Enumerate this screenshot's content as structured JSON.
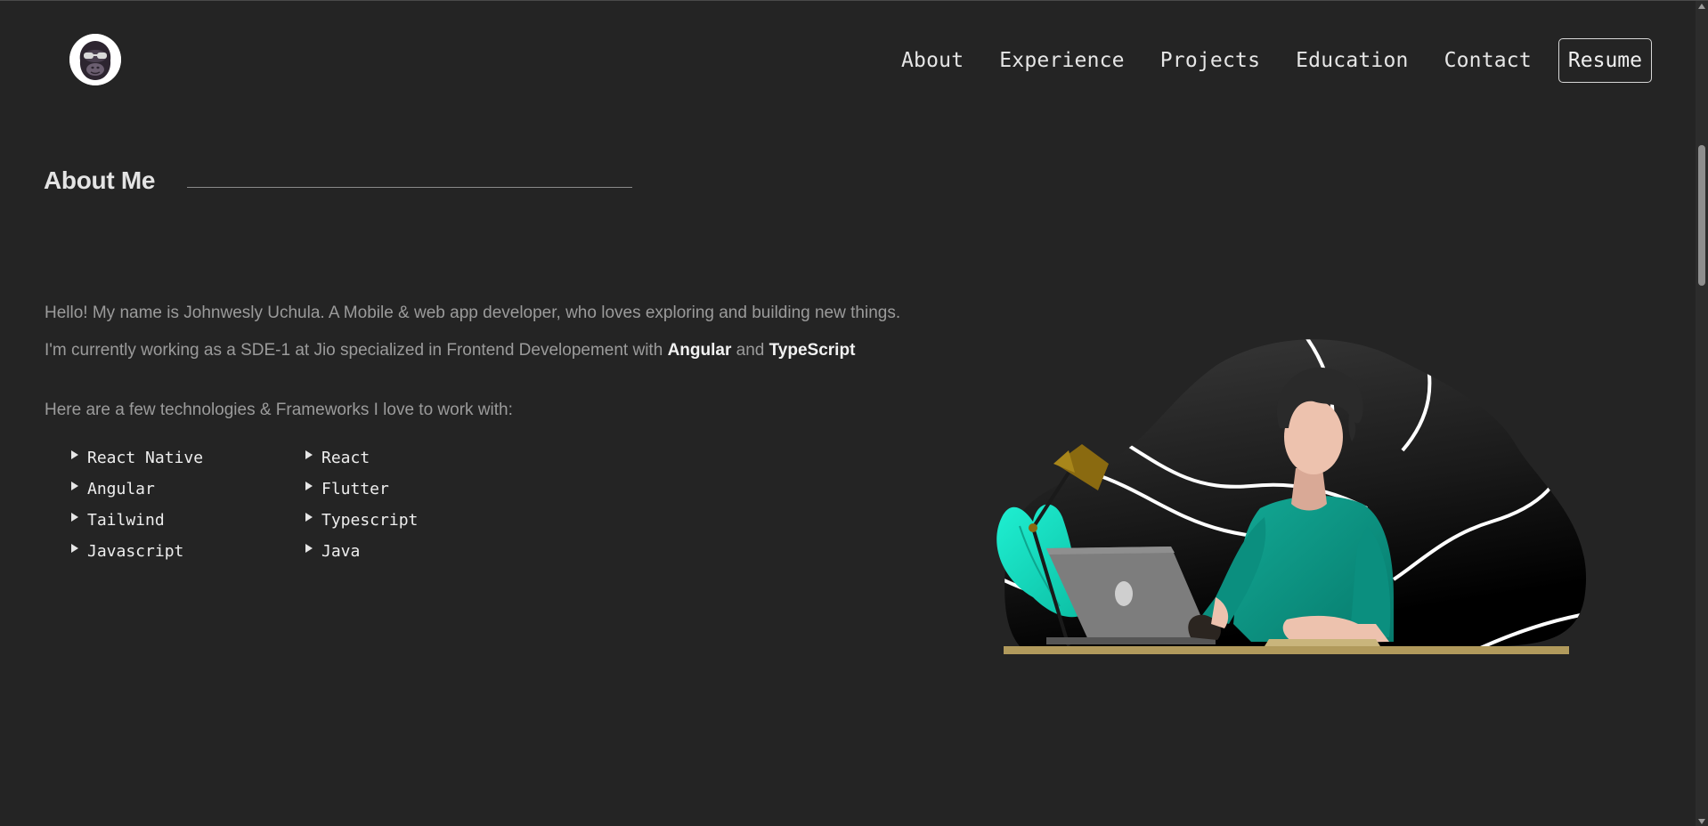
{
  "header": {
    "logo_icon": "gorilla-logo-icon",
    "nav": [
      "About",
      "Experience",
      "Projects",
      "Education",
      "Contact"
    ],
    "resume_label": "Resume"
  },
  "about": {
    "title": "About Me",
    "intro": "Hello! My name is Johnwesly Uchula. A Mobile & web app developer, who loves exploring and building new things.",
    "work_prefix": "I'm currently working as a SDE-1 at Jio specialized in Frontend Developement with ",
    "work_tech1": "Angular",
    "work_and": " and ",
    "work_tech2": "TypeScript",
    "tech_intro": "Here are a few technologies & Frameworks I love to work with:",
    "technologies": [
      "React Native",
      "React",
      "Angular",
      "Flutter",
      "Tailwind",
      "Typescript",
      "Javascript",
      "Java"
    ]
  },
  "illustration_icon": "developer-at-desk-illustration",
  "colors": {
    "background": "#242424",
    "shirt": "#0e9c8c",
    "plant": "#19e6c8",
    "lamp": "#8a6a10",
    "desk": "#b19a5c"
  }
}
